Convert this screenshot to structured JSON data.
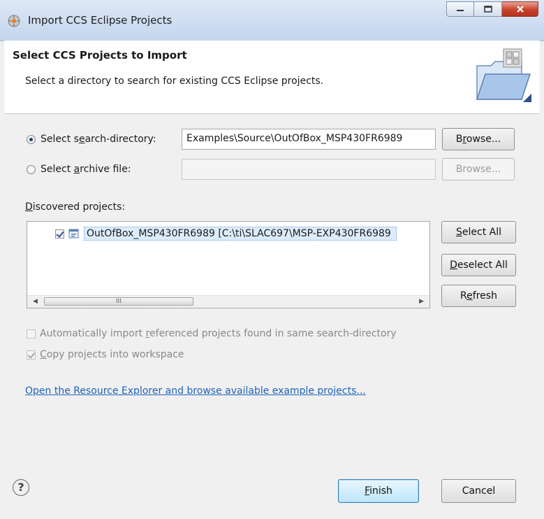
{
  "window": {
    "title": "Import CCS Eclipse Projects"
  },
  "header": {
    "title": "Select CCS Projects to Import",
    "description": "Select a directory to search for existing CCS Eclipse projects."
  },
  "search_directory": {
    "label_pre": "Select s",
    "label_acc": "e",
    "label_post": "arch-directory:",
    "selected": true,
    "value": "Examples\\Source\\OutOfBox_MSP430FR6989",
    "browse_pre": "B",
    "browse_acc": "r",
    "browse_post": "owse..."
  },
  "archive_file": {
    "label_pre": "Select ",
    "label_acc": "a",
    "label_post": "rchive file:",
    "selected": false,
    "value": "",
    "browse_label": "Browse..."
  },
  "discovered": {
    "label_acc": "D",
    "label_post": "iscovered projects:",
    "projects": [
      {
        "name": "OutOfBox_MSP430FR6989  [C:\\ti\\SLAC697\\MSP-EXP430FR6989",
        "checked": true
      }
    ],
    "scroll_thumb": "III"
  },
  "list_buttons": {
    "select_all_acc": "S",
    "select_all_post": "elect All",
    "deselect_all_acc": "D",
    "deselect_all_post": "eselect All",
    "refresh_pre": "R",
    "refresh_acc": "e",
    "refresh_post": "fresh"
  },
  "options": {
    "auto_import_pre": "Automatically import ",
    "auto_import_acc": "r",
    "auto_import_post": "eferenced projects found in same search-directory",
    "auto_import_checked": false,
    "copy_acc": "C",
    "copy_post": "opy projects into workspace",
    "copy_checked": true
  },
  "link_text": "Open the Resource Explorer and browse available example projects...",
  "footer": {
    "help_icon": "?",
    "finish_acc": "F",
    "finish_post": "inish",
    "cancel_label": "Cancel"
  },
  "colors": {
    "link": "#1f62b8",
    "selection": "#dcecfc",
    "close_button": "#c9422c"
  }
}
